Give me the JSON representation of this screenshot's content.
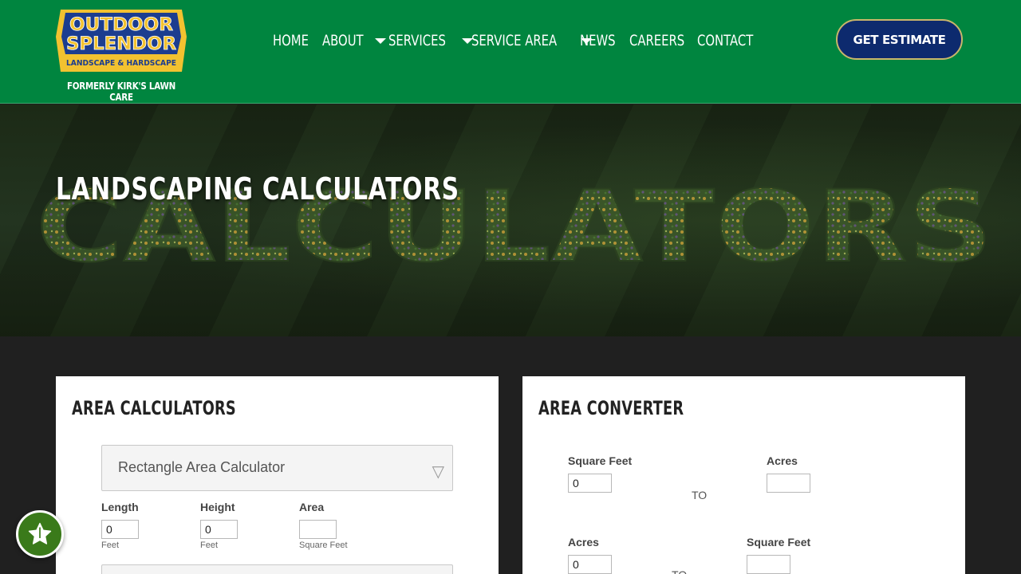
{
  "logo": {
    "line1": "OUTDOOR",
    "line2": "SPLENDOR",
    "tagline": "LANDSCAPE & HARDSCAPE",
    "subtitle": "FORMERLY KIRK'S LAWN CARE"
  },
  "nav": {
    "home": "HOME",
    "about": "ABOUT",
    "services": "SERVICES",
    "service_area": "SERVICE AREA",
    "news": "NEWS",
    "careers": "CAREERS",
    "contact": "CONTACT"
  },
  "header": {
    "estimate_label": "GET ESTIMATE"
  },
  "hero": {
    "title": "LANDSCAPING CALCULATORS",
    "background_word": "CALCULATORS"
  },
  "area_calculators": {
    "title": "AREA CALCULATORS",
    "selected_calculator": "Rectangle Area Calculator",
    "length_label": "Length",
    "length_value": "0",
    "length_unit": "Feet",
    "height_label": "Height",
    "height_value": "0",
    "height_unit": "Feet",
    "area_label": "Area",
    "area_value": "",
    "area_unit": "Square Feet"
  },
  "area_converter": {
    "title": "AREA CONVERTER",
    "row1": {
      "from_label": "Square Feet",
      "from_value": "0",
      "to_text": "TO",
      "to_label": "Acres",
      "to_value": ""
    },
    "row2": {
      "from_label": "Acres",
      "from_value": "0",
      "to_text": "TO",
      "to_label": "Square Feet",
      "to_value": ""
    }
  },
  "colors": {
    "header_green": "#00853f",
    "estimate_navy": "#0d2a6e",
    "logo_gold": "#f2c230",
    "page_dark": "#202020"
  },
  "icons": {
    "review": "star-icon",
    "dropdown": "caret-down-icon"
  }
}
